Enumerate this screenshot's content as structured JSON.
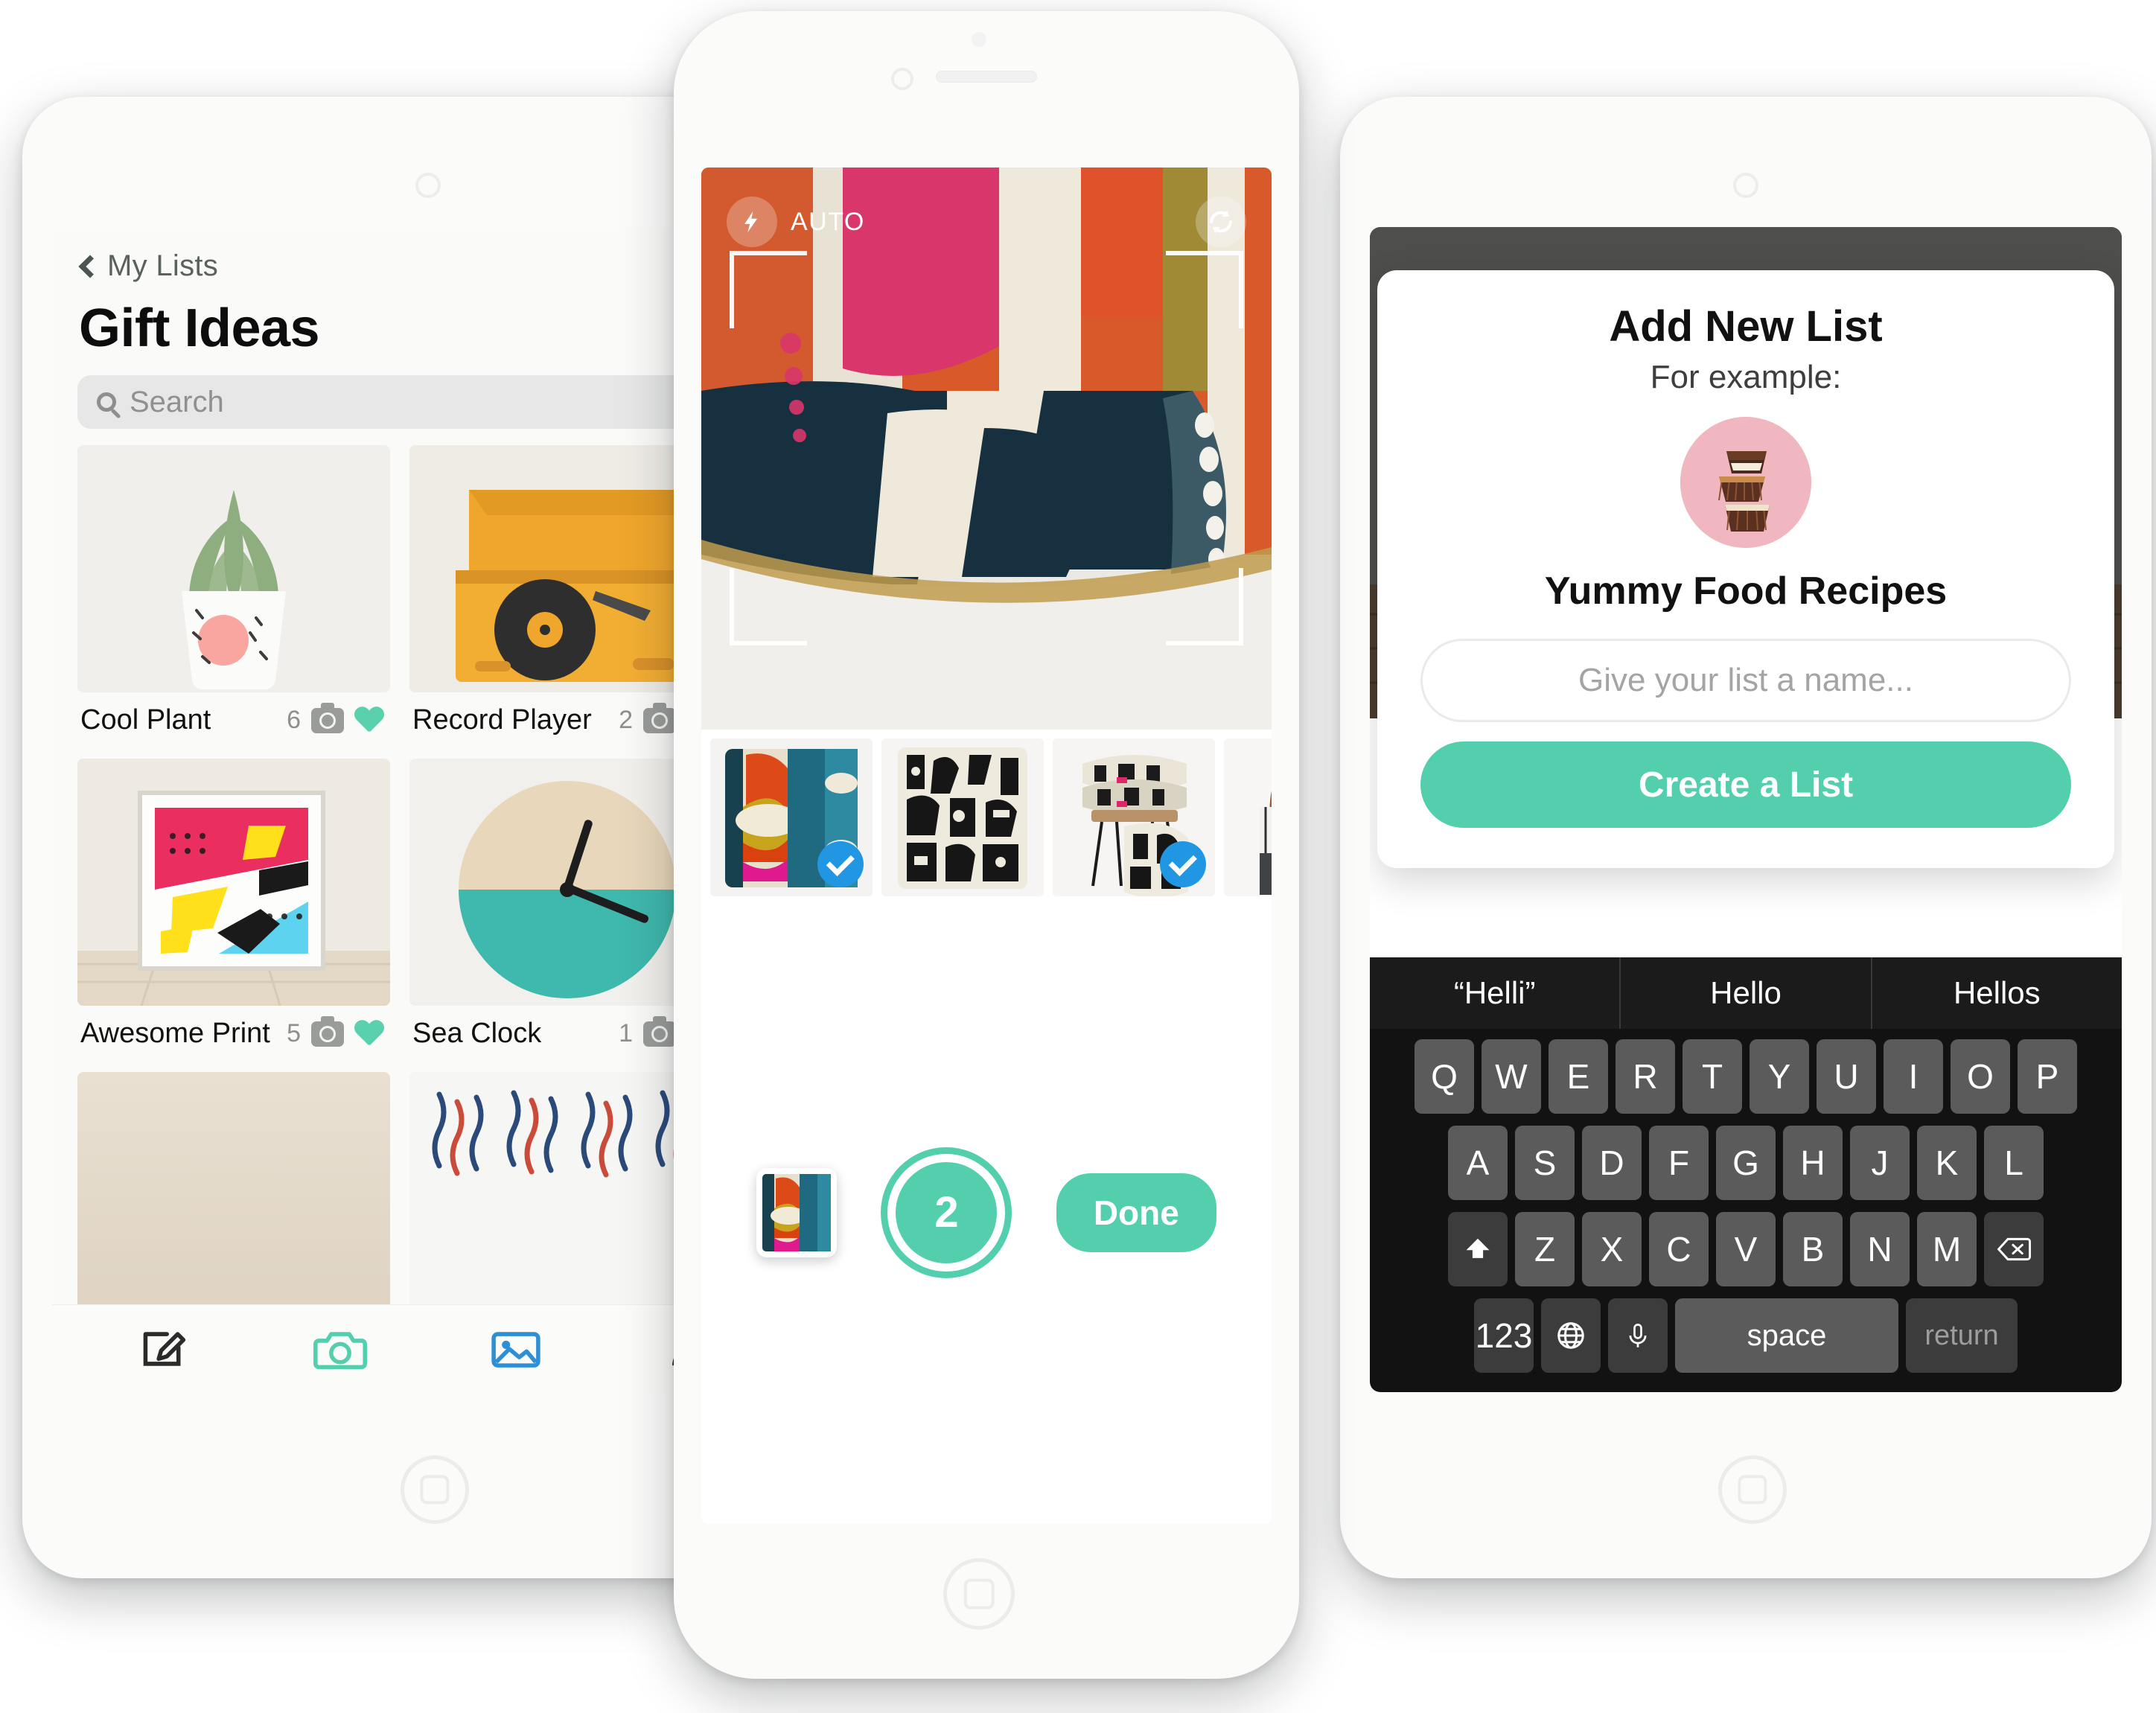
{
  "left_device": {
    "screen": "gift-ideas-list",
    "nav": {
      "back_label": "My Lists",
      "back_icon": "chevron-left-icon"
    },
    "title": "Gift Ideas",
    "search": {
      "placeholder": "Search",
      "icon": "search-icon"
    },
    "items": [
      {
        "name": "Cool Plant",
        "count": "6",
        "photo_icon": "camera-icon",
        "fav_icon": "heart-icon",
        "favorited": true
      },
      {
        "name": "Record Player",
        "count": "2",
        "photo_icon": "camera-icon",
        "fav_icon": "heart-icon",
        "favorited": true
      },
      {
        "name": "Awesome Print",
        "count": "5",
        "photo_icon": "camera-icon",
        "fav_icon": "heart-icon",
        "favorited": true
      },
      {
        "name": "Sea Clock",
        "count": "1",
        "photo_icon": "camera-icon",
        "fav_icon": "heart-icon",
        "favorited": true
      }
    ],
    "tabbar": [
      {
        "name": "edit-tab",
        "icon": "pencil-square-icon",
        "active": false
      },
      {
        "name": "camera-tab",
        "icon": "camera-icon",
        "active": true
      },
      {
        "name": "gallery-tab",
        "icon": "photo-icon",
        "active": true
      },
      {
        "name": "profile-tab",
        "icon": "person-icon",
        "active": false
      }
    ]
  },
  "center_device": {
    "screen": "camera-capture",
    "top_bar": {
      "flash_icon": "flash-bolt-icon",
      "flash_mode": "AUTO",
      "flip_icon": "camera-flip-icon"
    },
    "focus_frame_icon": "focus-brackets-icon",
    "thumbnails": [
      {
        "name": "Colorful geometric cushion",
        "selected": true,
        "check_icon": "check-circle-icon"
      },
      {
        "name": "Black and white pattern cushion",
        "selected": false,
        "check_icon": "check-circle-icon"
      },
      {
        "name": "Stacked cushions on stool",
        "selected": true,
        "check_icon": "check-circle-icon"
      },
      {
        "name": "Striped tote bag",
        "selected": false,
        "check_icon": "check-circle-icon"
      }
    ],
    "controls": {
      "last_shot_label": "last-captured-thumbnail",
      "shutter_count": "2",
      "done_label": "Done"
    }
  },
  "right_device": {
    "screen": "add-new-list",
    "background_icon": "cloud-sync-icon",
    "modal": {
      "title": "Add New List",
      "subtitle": "For example:",
      "example_avatar": "cupcakes-photo",
      "example_name": "Yummy Food Recipes",
      "input_placeholder": "Give your list a name...",
      "create_label": "Create a List"
    },
    "keyboard": {
      "suggestions": [
        "“Helli”",
        "Hello",
        "Hellos"
      ],
      "row1": [
        "Q",
        "W",
        "E",
        "R",
        "T",
        "Y",
        "U",
        "I",
        "O",
        "P"
      ],
      "row2": [
        "A",
        "S",
        "D",
        "F",
        "G",
        "H",
        "J",
        "K",
        "L"
      ],
      "row3_shift_icon": "shift-icon",
      "row3": [
        "Z",
        "X",
        "C",
        "V",
        "B",
        "N",
        "M"
      ],
      "row3_backspace_icon": "backspace-icon",
      "row4_numbers": "123",
      "row4_globe_icon": "globe-icon",
      "row4_mic_icon": "microphone-icon",
      "row4_space": "space",
      "row4_return": "return"
    }
  },
  "colors": {
    "accent_teal": "#54cfae",
    "check_blue": "#2196e3",
    "keyboard_bg": "#121212",
    "key_bg": "#5b5b5b",
    "avatar_pink": "#f0b7c0"
  }
}
